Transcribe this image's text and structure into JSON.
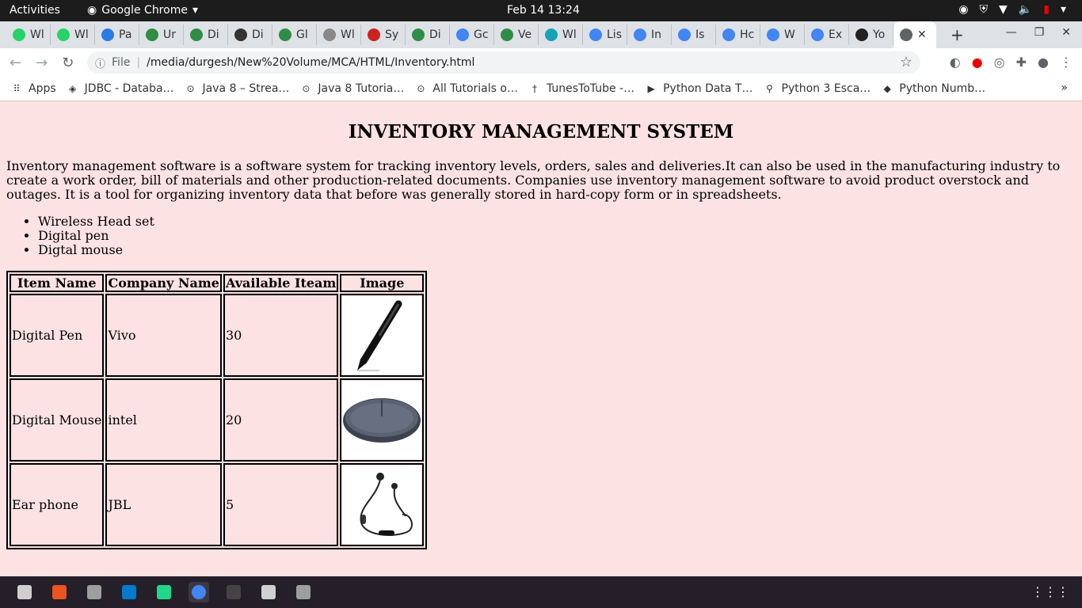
{
  "system_bar": {
    "activities": "Activities",
    "app_name": "Google Chrome",
    "datetime": "Feb 14  13:24"
  },
  "tabs": [
    {
      "label": "Wl",
      "color": "#25d366"
    },
    {
      "label": "Wl",
      "color": "#25d366"
    },
    {
      "label": "Pa",
      "color": "#2c7be5"
    },
    {
      "label": "Ur",
      "color": "#2f8d46"
    },
    {
      "label": "Di",
      "color": "#2f8d46"
    },
    {
      "label": "Di",
      "color": "#333333"
    },
    {
      "label": "Gl",
      "color": "#2f8d46"
    },
    {
      "label": "Wl",
      "color": "#888888"
    },
    {
      "label": "Sy",
      "color": "#cc2222"
    },
    {
      "label": "Di",
      "color": "#2f8d46"
    },
    {
      "label": "Gc",
      "color": "#4285f4"
    },
    {
      "label": "Ve",
      "color": "#2f8d46"
    },
    {
      "label": "Wl",
      "color": "#17a2b8"
    },
    {
      "label": "Lis",
      "color": "#4285f4"
    },
    {
      "label": "In",
      "color": "#4285f4"
    },
    {
      "label": "Is",
      "color": "#4285f4"
    },
    {
      "label": "Hc",
      "color": "#4285f4"
    },
    {
      "label": "W",
      "color": "#4285f4"
    },
    {
      "label": "Ex",
      "color": "#4285f4"
    },
    {
      "label": "Yo",
      "color": "#222222"
    }
  ],
  "address_bar": {
    "scheme": "File",
    "url": "/media/durgesh/New%20Volume/MCA/HTML/Inventory.html"
  },
  "bookmarks": [
    {
      "label": "Apps",
      "icon": "apps-grid-icon"
    },
    {
      "label": "JDBC - Databa…",
      "icon": "diamond-icon"
    },
    {
      "label": "Java 8 – Strea…",
      "icon": "globe-icon"
    },
    {
      "label": "Java 8 Tutoria…",
      "icon": "globe-icon"
    },
    {
      "label": "All Tutorials o…",
      "icon": "globe-icon"
    },
    {
      "label": "TunesToTube -…",
      "icon": "cross-icon"
    },
    {
      "label": "Python Data T…",
      "icon": "p-icon"
    },
    {
      "label": "Python 3 Esca…",
      "icon": "search-icon"
    },
    {
      "label": "Python Numb…",
      "icon": "python-icon"
    }
  ],
  "page": {
    "title": "INVENTORY MANAGEMENT SYSTEM",
    "intro": "Inventory management software is a software system for tracking inventory levels, orders, sales and deliveries.It can also be used in the manufacturing industry to create a work order, bill of materials and other production-related documents. Companies use inventory management software to avoid product overstock and outages. It is a tool for organizing inventory data that before was generally stored in hard-copy form or in spreadsheets.",
    "products": [
      "Wireless Head set",
      "Digital pen",
      "Digtal mouse"
    ],
    "table": {
      "headers": [
        "Item Name",
        "Company Name",
        "Available Iteam",
        "Image"
      ],
      "rows": [
        {
          "item": "Digital Pen",
          "company": "Vivo",
          "available": "30",
          "image": "digital-pen"
        },
        {
          "item": "Digital Mouse",
          "company": "intel",
          "available": "20",
          "image": "digital-mouse"
        },
        {
          "item": "Ear phone",
          "company": "JBL",
          "available": "5",
          "image": "ear-phone"
        }
      ]
    }
  },
  "dock": [
    {
      "name": "files",
      "color": "#cfcfcf"
    },
    {
      "name": "software",
      "color": "#e95420"
    },
    {
      "name": "updater",
      "color": "#9e9e9e"
    },
    {
      "name": "vscode",
      "color": "#007acc"
    },
    {
      "name": "pycharm",
      "color": "#21d789"
    },
    {
      "name": "chrome",
      "color": "#4285f4"
    },
    {
      "name": "terminal",
      "color": "#444444"
    },
    {
      "name": "document-viewer",
      "color": "#d0d0d0"
    },
    {
      "name": "disk",
      "color": "#9e9e9e"
    }
  ]
}
